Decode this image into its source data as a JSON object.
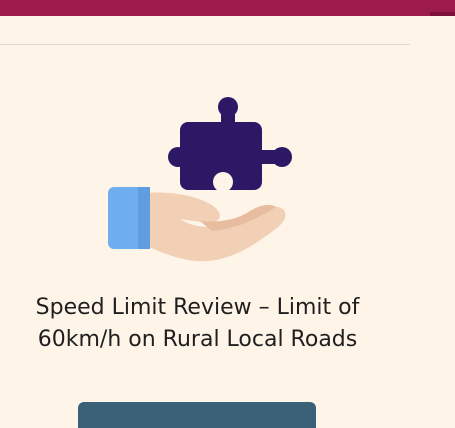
{
  "card": {
    "title_line1": "Speed Limit Review – Limit of",
    "title_line2": "60km/h on Rural Local Roads"
  },
  "icons": {
    "hero": "hand-holding-puzzle-icon"
  },
  "colors": {
    "top_bar": "#9c1b4c",
    "background": "#fef4e8",
    "puzzle": "#2d1865",
    "sleeve": "#6faef0",
    "hand": "#f2d0b6",
    "button": "#3b6178"
  }
}
